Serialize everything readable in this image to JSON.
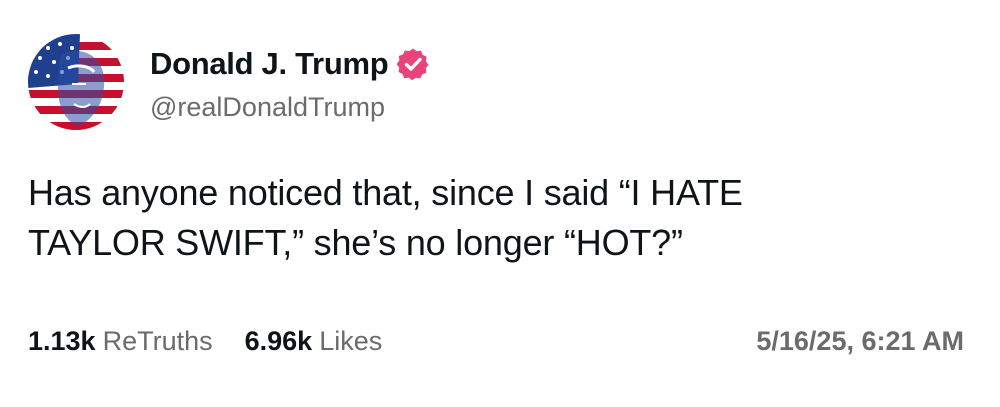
{
  "author": {
    "display_name": "Donald J. Trump",
    "handle": "@realDonaldTrump",
    "verified_badge_icon": "verified-badge-icon",
    "verified_color": "#e8437a"
  },
  "post": {
    "text_lines": [
      "Has anyone noticed that, since I said “I HATE",
      "TAYLOR SWIFT,” she’s no longer “HOT?”"
    ]
  },
  "stats": {
    "retruths_count": "1.13k",
    "retruths_label": "ReTruths",
    "likes_count": "6.96k",
    "likes_label": "Likes",
    "timestamp": "5/16/25, 6:21 AM"
  }
}
